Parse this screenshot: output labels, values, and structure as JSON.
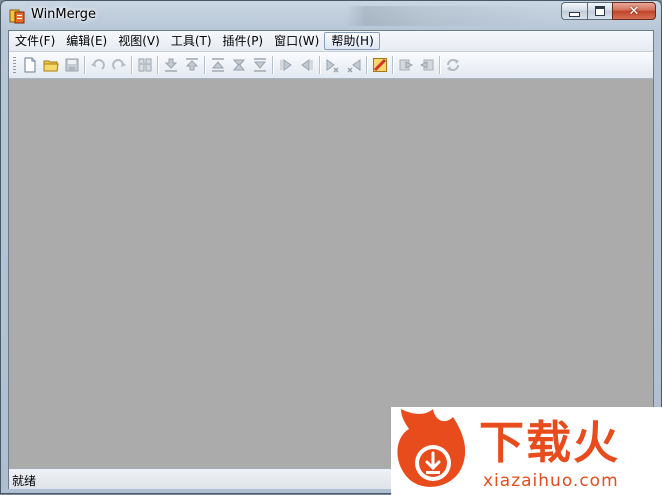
{
  "window": {
    "title": "WinMerge"
  },
  "caption": {
    "close_symbol": "✕"
  },
  "menu": [
    {
      "label": "文件(F)"
    },
    {
      "label": "编辑(E)"
    },
    {
      "label": "视图(V)"
    },
    {
      "label": "工具(T)"
    },
    {
      "label": "插件(P)"
    },
    {
      "label": "窗口(W)"
    },
    {
      "label": "帮助(H)"
    }
  ],
  "toolbar": {
    "icons": [
      "new-file-icon",
      "open-folder-icon",
      "save-icon",
      "undo-icon",
      "redo-icon",
      "merge-view-icon",
      "next-diff-icon",
      "prev-diff-icon",
      "first-diff-icon",
      "current-diff-icon",
      "last-diff-icon",
      "copy-right-icon",
      "copy-left-icon",
      "copy-right-advance-icon",
      "copy-left-advance-icon",
      "options-icon",
      "copy-all-right-icon",
      "copy-all-left-icon",
      "refresh-icon"
    ]
  },
  "status": {
    "text": "就绪"
  },
  "watermark": {
    "brand": "下载火",
    "url": "xiazaihuo.com"
  },
  "colors": {
    "workspace": "#ababab",
    "brand": "#e84c1d"
  }
}
